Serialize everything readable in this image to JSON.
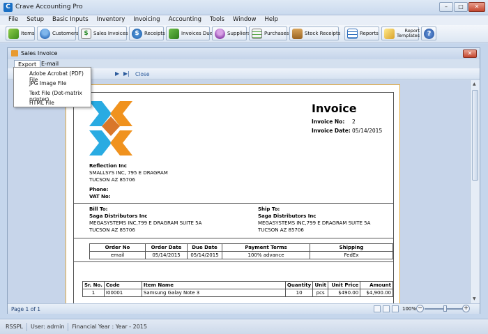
{
  "app": {
    "title": "Crave Accounting Pro",
    "icon_letter": "C"
  },
  "window_controls": {
    "minimize": "–",
    "maximize": "□",
    "close": "✕"
  },
  "menu": [
    "File",
    "Setup",
    "Basic Inputs",
    "Inventory",
    "Invoicing",
    "Accounting",
    "Tools",
    "Window",
    "Help"
  ],
  "toolbar": {
    "items": "Items",
    "customers": "Customers",
    "sales_invoices": "Sales Invoices",
    "receipts": "Receipts",
    "invoices_due": "Invoices Due",
    "suppliers": "Suppliers",
    "purchases": "Purchases",
    "stock_receipts": "Stock Receipts",
    "reports": "Reports",
    "report_templates_1": "Report",
    "report_templates_2": "Templates"
  },
  "child_window": {
    "title": "Sales Invoice",
    "close": "✕",
    "tabs": [
      "Export",
      "E-mail"
    ],
    "nav_close": "Close",
    "page_info": "Page 1 of 1",
    "zoom": "100%"
  },
  "export_menu": [
    "Adobe Acrobat (PDF) File",
    "JPG Image File",
    "Text File (Dot-matrix printer)",
    "HTML File"
  ],
  "invoice": {
    "title": "Invoice",
    "invoice_no_label": "Invoice No:",
    "invoice_no": "2",
    "invoice_date_label": "Invoice Date:",
    "invoice_date": "05/14/2015",
    "seller": {
      "name": "Reflection Inc",
      "line1": "SMALLSYS INC, 795 E DRAGRAM",
      "line2": "TUCSON AZ 85706",
      "phone_label": "Phone:",
      "vat_label": "VAT No:"
    },
    "bill_to": {
      "label": "Bill To:",
      "name": "Saga Distributors Inc",
      "line1": "MEGASYSTEMS INC,799 E DRAGRAM SUITE 5A",
      "line2": "TUCSON AZ  85706"
    },
    "ship_to": {
      "label": "Ship To:",
      "name": "Saga Distributors Inc",
      "line1": "MEGASYSTEMS INC,799 E DRAGRAM SUITE 5A",
      "line2": "TUCSON AZ  85706"
    },
    "order_headers": [
      "Order No",
      "Order Date",
      "Due Date",
      "Payment Terms",
      "Shipping"
    ],
    "order_row": [
      "email",
      "05/14/2015",
      "05/14/2015",
      "100% advance",
      "FedEx"
    ],
    "item_headers": [
      "Sr. No.",
      "Code",
      "Item Name",
      "Quantity",
      "Unit",
      "Unit Price",
      "Amount"
    ],
    "item_row": [
      "1",
      "I00001",
      "Samsung Galay Note 3",
      "10",
      "pcs",
      "$490.00",
      "$4,900.00"
    ]
  },
  "status": {
    "company": "RSSPL",
    "user": "User: admin",
    "year": "Financial Year : Year - 2015"
  },
  "colors": {
    "logo_orange": "#f0921e",
    "logo_blue": "#29abe2",
    "accent": "#1a6fc4"
  }
}
